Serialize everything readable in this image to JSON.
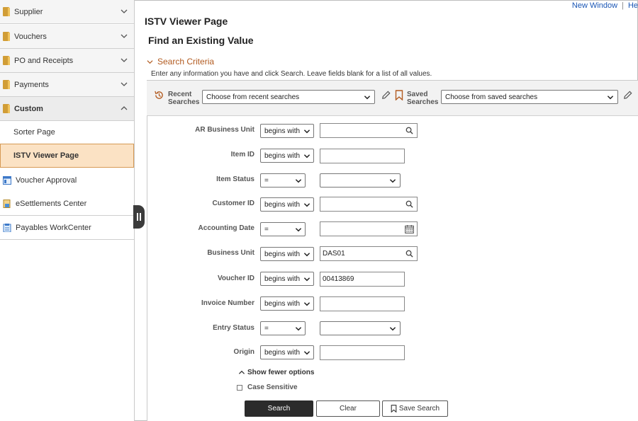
{
  "top_links": {
    "new_window": "New Window",
    "help": "He"
  },
  "page": {
    "title": "ISTV Viewer Page",
    "find_title": "Find an Existing Value"
  },
  "sidebar": {
    "groups": [
      {
        "label": "Supplier"
      },
      {
        "label": "Vouchers"
      },
      {
        "label": "PO and Receipts"
      },
      {
        "label": "Payments"
      },
      {
        "label": "Custom"
      }
    ],
    "sub_items": [
      {
        "label": "Sorter Page"
      },
      {
        "label": "ISTV Viewer Page"
      }
    ],
    "tiles": [
      {
        "label": "Voucher Approval"
      },
      {
        "label": "eSettlements Center"
      },
      {
        "label": "Payables WorkCenter"
      }
    ]
  },
  "search": {
    "header": "Search Criteria",
    "instructions": "Enter any information you have and click Search. Leave fields blank for a list of all values.",
    "recent_label_1": "Recent",
    "recent_label_2": "Searches",
    "recent_placeholder": "Choose from recent searches",
    "saved_label_1": "Saved",
    "saved_label_2": "Searches",
    "saved_placeholder": "Choose from saved searches",
    "fields": [
      {
        "label": "AR Business Unit",
        "operator": "begins with",
        "value": ""
      },
      {
        "label": "Item ID",
        "operator": "begins with",
        "value": ""
      },
      {
        "label": "Item Status",
        "operator": "=",
        "value": ""
      },
      {
        "label": "Customer ID",
        "operator": "begins with",
        "value": ""
      },
      {
        "label": "Accounting Date",
        "operator": "=",
        "value": ""
      },
      {
        "label": "Business Unit",
        "operator": "begins with",
        "value": "DAS01"
      },
      {
        "label": "Voucher ID",
        "operator": "begins with",
        "value": "00413869"
      },
      {
        "label": "Invoice Number",
        "operator": "begins with",
        "value": ""
      },
      {
        "label": "Entry Status",
        "operator": "=",
        "value": ""
      },
      {
        "label": "Origin",
        "operator": "begins with",
        "value": ""
      }
    ],
    "show_fewer": "Show fewer options",
    "case_sensitive": "Case Sensitive"
  },
  "buttons": {
    "search": "Search",
    "clear": "Clear",
    "save_search": "Save Search"
  },
  "colors": {
    "accent": "#b25b20",
    "active_bg": "#fbe2c4",
    "link": "#1a56b5",
    "primary_btn": "#2b2b2b"
  }
}
